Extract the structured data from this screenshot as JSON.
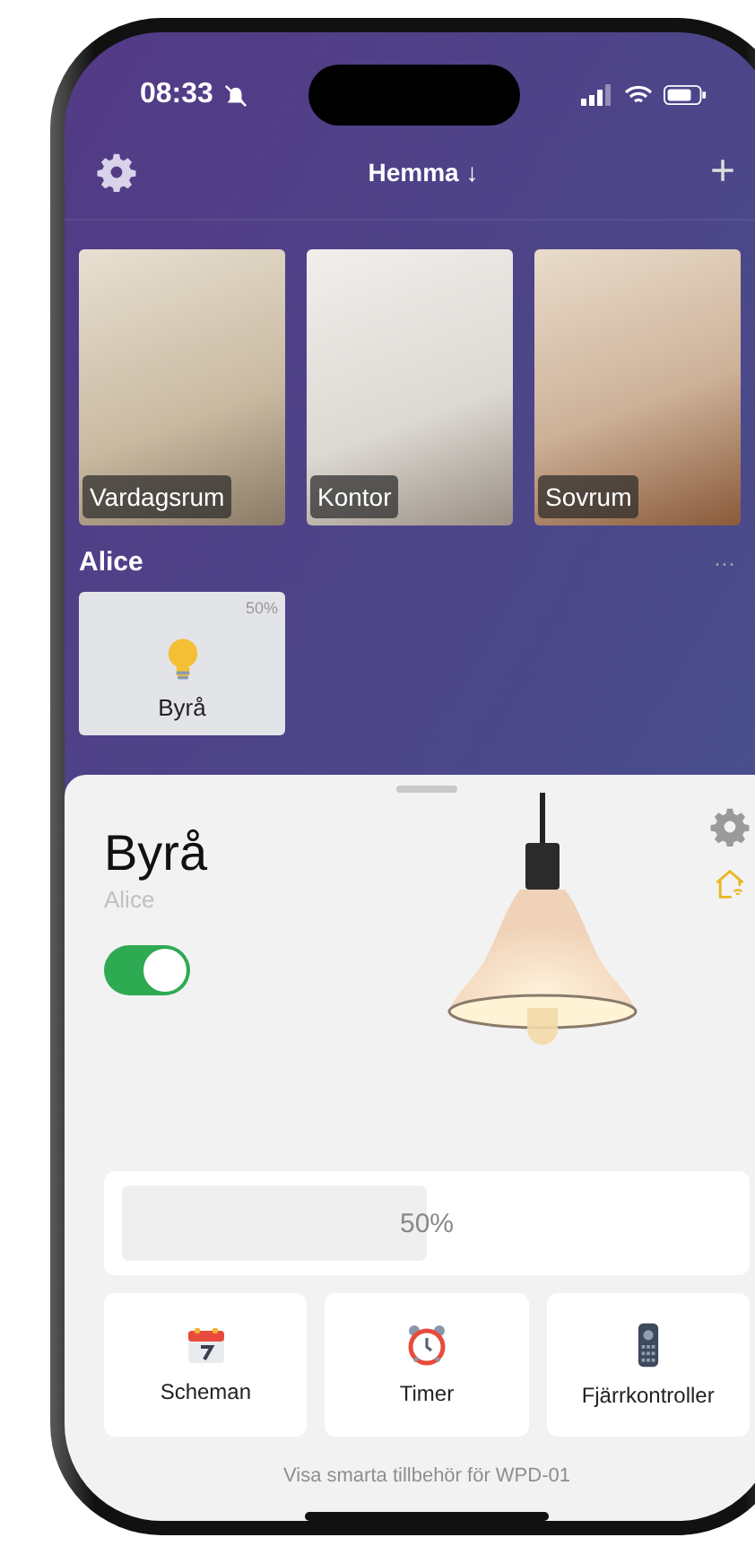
{
  "status_bar": {
    "time": "08:33",
    "silent": true
  },
  "header": {
    "title": "Hemma ↓",
    "add": "+"
  },
  "rooms": [
    {
      "name": "Vardagsrum"
    },
    {
      "name": "Kontor"
    },
    {
      "name": "Sovrum"
    }
  ],
  "section": {
    "title": "Alice",
    "more": "···"
  },
  "devices": [
    {
      "name": "Byrå",
      "reading": "50%"
    }
  ],
  "sheet": {
    "title": "Byrå",
    "subtitle": "Alice",
    "on": true,
    "brightness": {
      "level": 0.5,
      "reading": "50%"
    },
    "actions": [
      {
        "kind": "schedule",
        "label": "Scheman"
      },
      {
        "kind": "timer",
        "label": "Timer"
      },
      {
        "kind": "remote",
        "label": "Fjärrkontroller"
      }
    ],
    "footer": "Visa smarta tillbehör för WPD-01"
  }
}
